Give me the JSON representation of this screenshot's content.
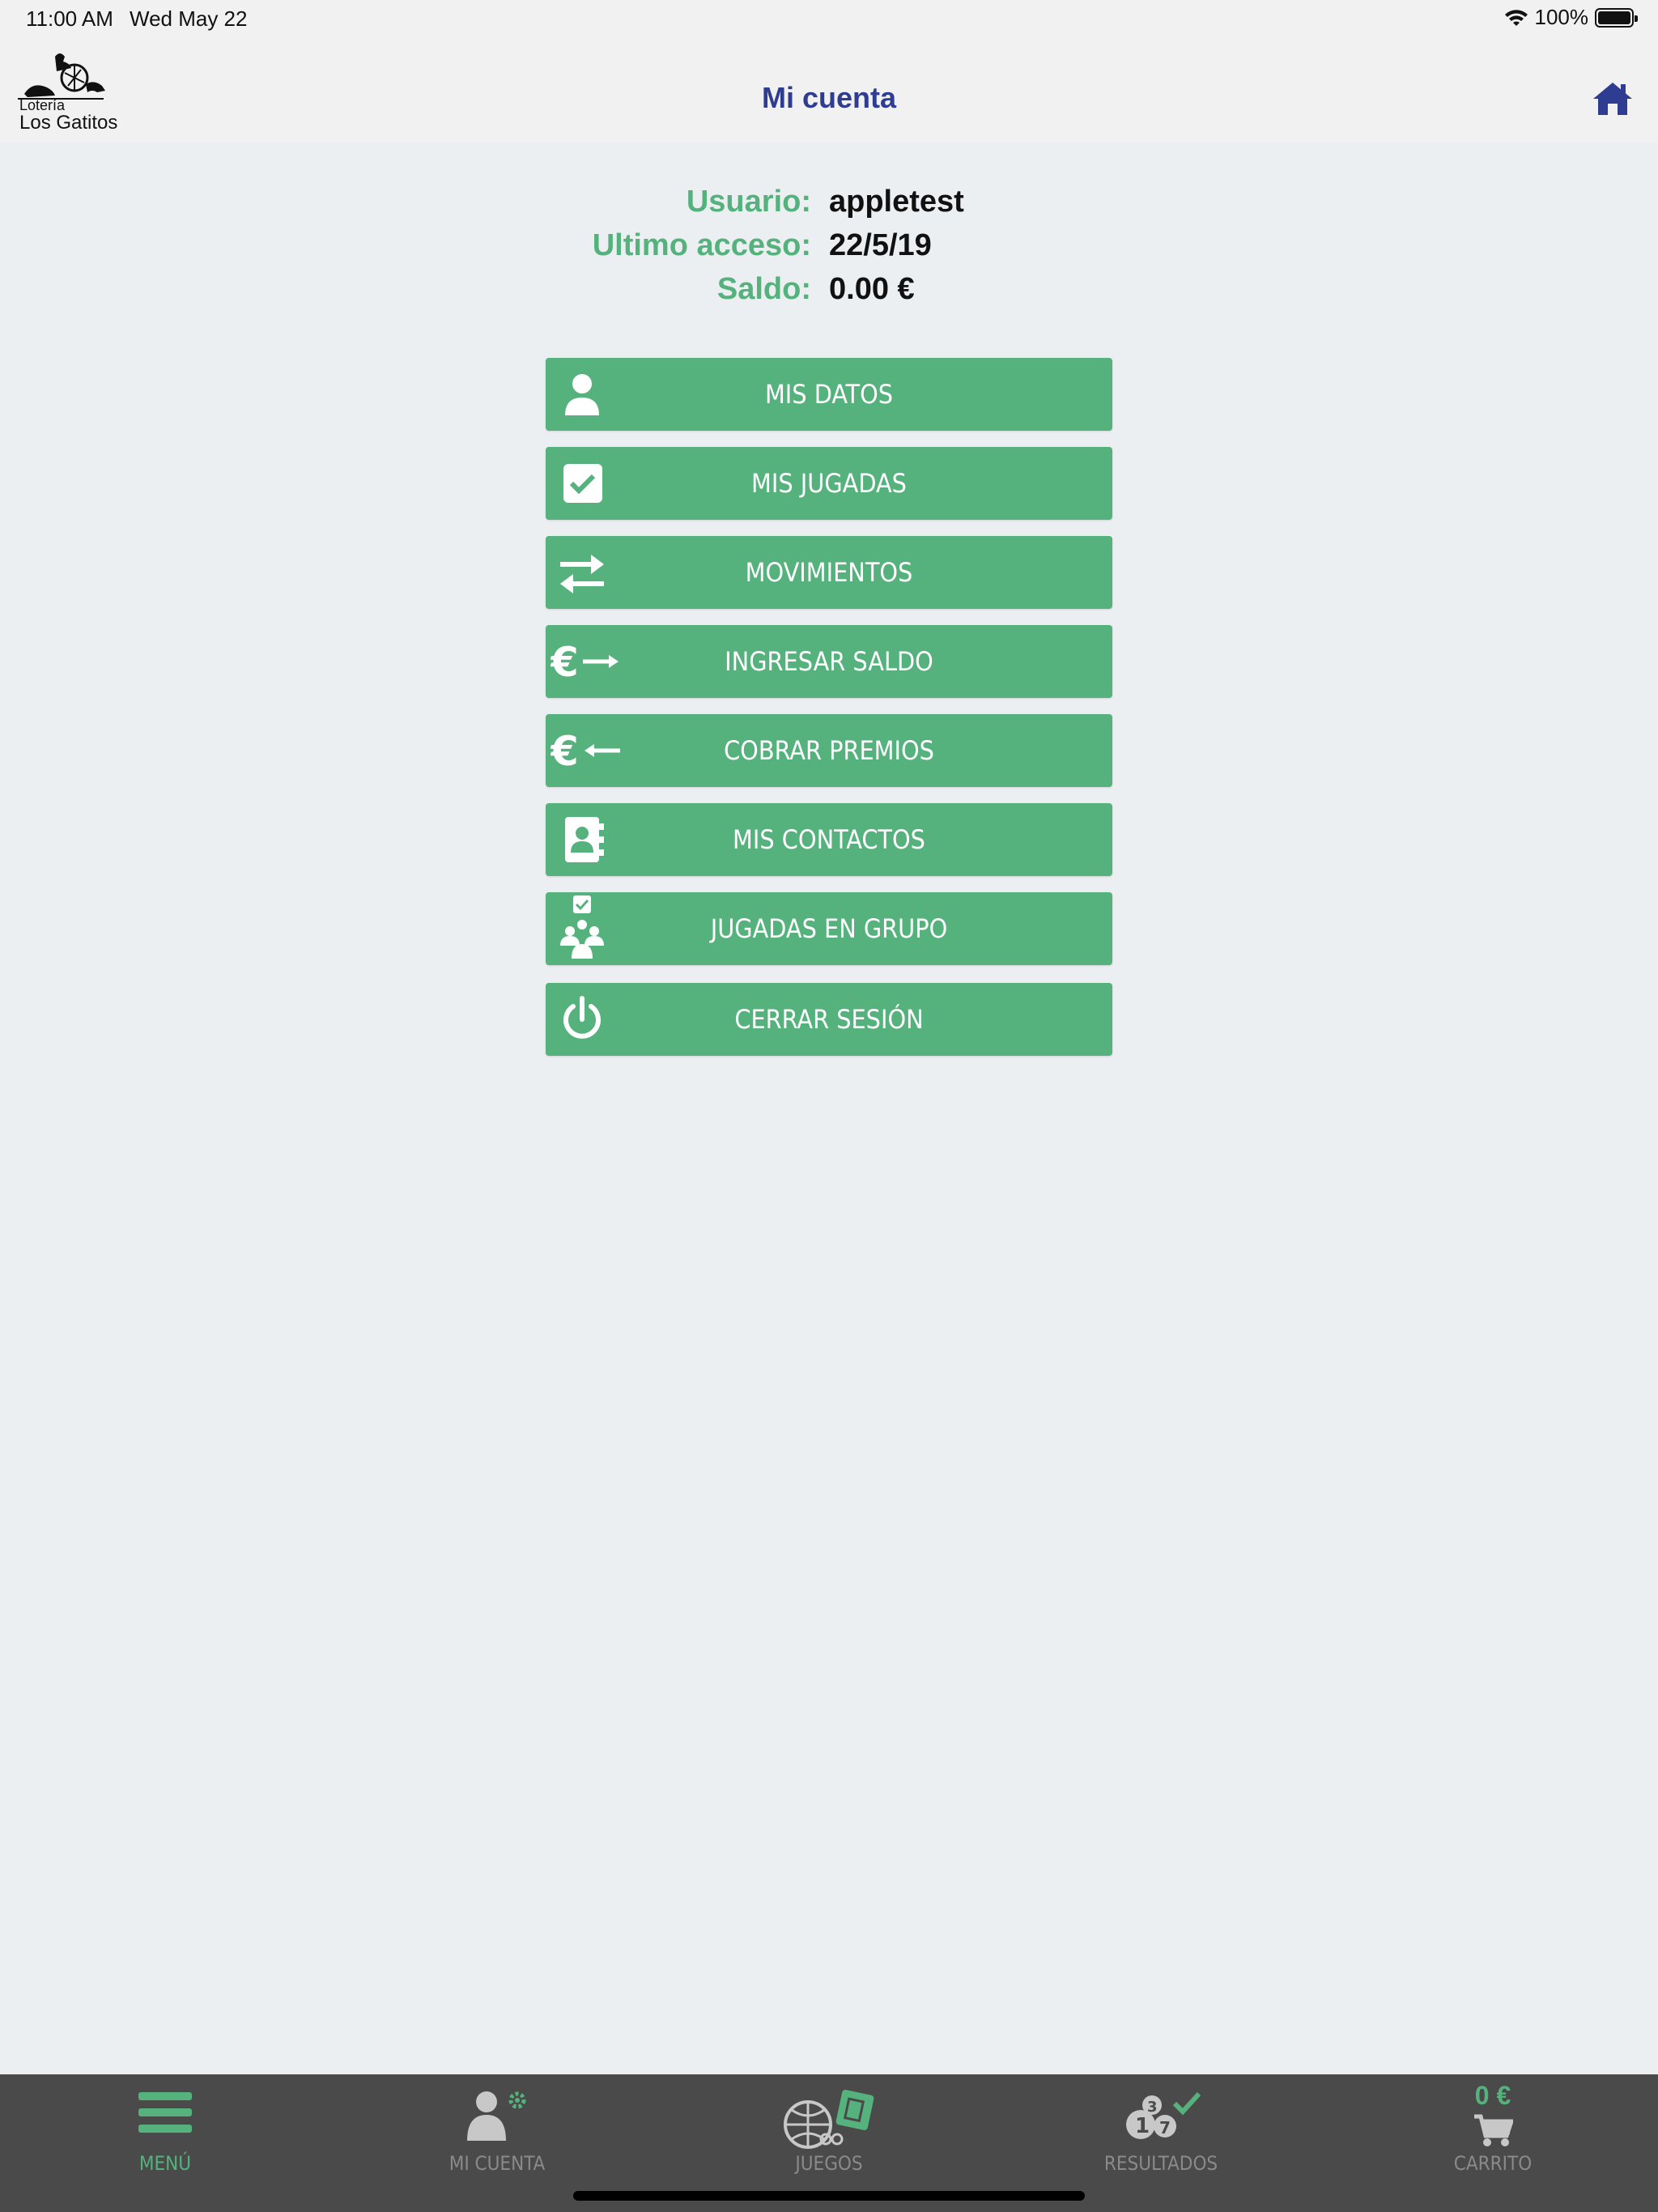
{
  "status_bar": {
    "time": "11:00 AM",
    "date": "Wed May 22",
    "battery": "100%"
  },
  "header": {
    "title": "Mi cuenta",
    "logo_line1": "Lotería",
    "logo_line2": "Los Gatitos"
  },
  "account": {
    "user_label": "Usuario:",
    "user_value": "appletest",
    "last_access_label": "Ultimo acceso:",
    "last_access_value": "22/5/19",
    "balance_label": "Saldo:",
    "balance_value": "0.00 €"
  },
  "menu": {
    "items": [
      {
        "label": "MIS DATOS",
        "icon": "user-icon"
      },
      {
        "label": "MIS JUGADAS",
        "icon": "checkbox-icon"
      },
      {
        "label": "MOVIMIENTOS",
        "icon": "transfer-arrows-icon"
      },
      {
        "label": "INGRESAR SALDO",
        "icon": "euro-deposit-icon"
      },
      {
        "label": "COBRAR PREMIOS",
        "icon": "euro-withdraw-icon"
      },
      {
        "label": "MIS CONTACTOS",
        "icon": "address-book-icon"
      },
      {
        "label": "JUGADAS EN GRUPO",
        "icon": "group-play-icon"
      },
      {
        "label": "CERRAR SESIÓN",
        "icon": "power-icon"
      }
    ]
  },
  "tabbar": {
    "menu": "MENÚ",
    "account": "MI CUENTA",
    "games": "JUEGOS",
    "results": "RESULTADOS",
    "cart": "CARRITO",
    "cart_amount": "0 €"
  },
  "colors": {
    "accent": "#55B27D",
    "title": "#2E3C91",
    "tabbar": "#4A4A4A",
    "background": "#ECEFF2"
  }
}
